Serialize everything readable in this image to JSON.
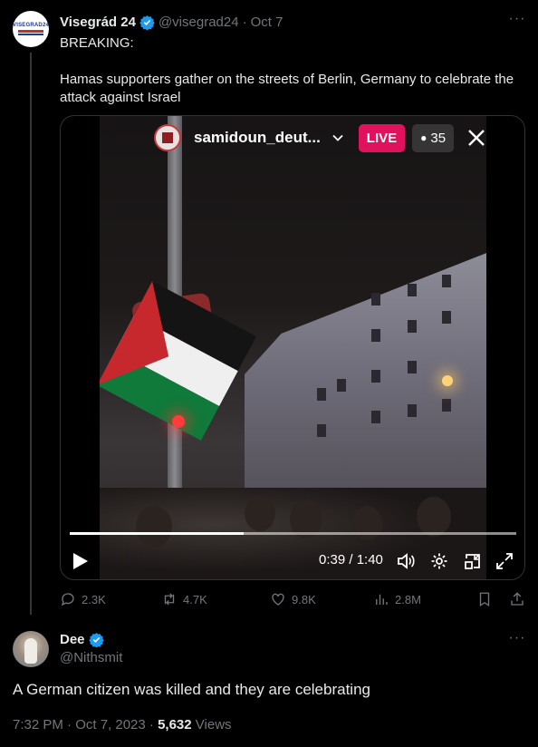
{
  "tweet": {
    "author_name": "Visegrád 24",
    "author_logo_text": "VISEGRAD24",
    "author_handle": "@visegrad24",
    "separator": "·",
    "time": "Oct 7",
    "more": "···",
    "text_line1": "BREAKING:",
    "text_line2": "Hamas supporters gather on the streets of Berlin, Germany to celebrate the attack against Israel"
  },
  "video": {
    "live_user": "samidoun_deut...",
    "live_label": "LIVE",
    "viewer_count": "35",
    "time_display": "0:39 / 1:40",
    "progress": 0.39
  },
  "actions": {
    "replies": "2.3K",
    "reposts": "4.7K",
    "likes": "9.8K",
    "views": "2.8M"
  },
  "reply": {
    "name": "Dee",
    "handle": "@Nithsmit",
    "more": "···",
    "text": "A German citizen was killed and they are celebrating",
    "timestamp": "7:32 PM · Oct 7, 2023 · ",
    "views_count": "5,632",
    "views_label": " Views"
  },
  "colors": {
    "background": "#000000",
    "text": "#e7e9ea",
    "muted": "#71767b",
    "verified": "#1d9bf0",
    "live": "#e0125e"
  }
}
